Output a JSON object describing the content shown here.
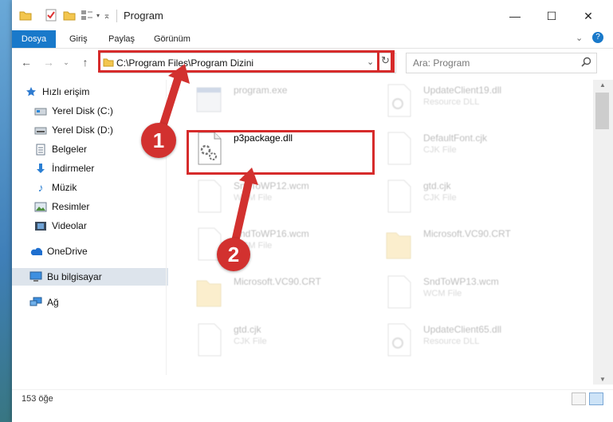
{
  "window": {
    "title": "Program",
    "controls": {
      "minimize": "—",
      "maximize": "☐",
      "close": "✕"
    }
  },
  "ribbon": {
    "tabs": [
      "Dosya",
      "Giriş",
      "Paylaş",
      "Görünüm"
    ],
    "collapse_icon": "chevron-down-icon",
    "help_icon": "help-icon"
  },
  "navigation": {
    "address": "C:\\Program Files\\Program Dizini",
    "search_placeholder": "Ara: Program"
  },
  "sidebar": {
    "items": [
      {
        "label": "Hızlı erişim",
        "icon": "star-icon",
        "pinned": false
      },
      {
        "label": "Yerel Disk (C:)",
        "icon": "drive-icon",
        "pinned": true
      },
      {
        "label": "Yerel Disk (D:)",
        "icon": "drive-icon",
        "pinned": false
      },
      {
        "label": "Belgeler",
        "icon": "documents-icon",
        "pinned": true
      },
      {
        "label": "İndirmeler",
        "icon": "download-icon",
        "pinned": true
      },
      {
        "label": "Müzik",
        "icon": "music-icon",
        "pinned": true
      },
      {
        "label": "Resimler",
        "icon": "pictures-icon",
        "pinned": true
      },
      {
        "label": "Videolar",
        "icon": "video-icon",
        "pinned": true
      },
      {
        "label": "OneDrive",
        "icon": "cloud-icon",
        "pinned": false
      },
      {
        "label": "Bu bilgisayar",
        "icon": "computer-icon",
        "pinned": false,
        "selected": true
      },
      {
        "label": "Ağ",
        "icon": "network-icon",
        "pinned": false
      }
    ]
  },
  "files": [
    {
      "name": "program.exe",
      "type": "",
      "icon": "exe-icon",
      "faded": true
    },
    {
      "name": "UpdateClient19.dll",
      "type": "Resource DLL",
      "icon": "dll-icon",
      "faded": true
    },
    {
      "name": "p3package.dll",
      "type": "",
      "icon": "gear-file-icon",
      "faded": false,
      "highlighted": true
    },
    {
      "name": "DefaultFont.cjk",
      "type": "CJK File",
      "icon": "file-icon",
      "faded": true
    },
    {
      "name": "SndToWP12.wcm",
      "type": "WCM File",
      "icon": "file-icon",
      "faded": true
    },
    {
      "name": "gtd.cjk",
      "type": "CJK File",
      "icon": "file-icon",
      "faded": true
    },
    {
      "name": "SndToWP16.wcm",
      "type": "WCM File",
      "icon": "file-icon",
      "faded": true
    },
    {
      "name": "Microsoft.VC90.CRT",
      "type": "",
      "icon": "folder-icon",
      "faded": true
    },
    {
      "name": "Microsoft.VC90.CRT",
      "type": "",
      "icon": "folder-icon",
      "faded": true
    },
    {
      "name": "SndToWP13.wcm",
      "type": "WCM File",
      "icon": "file-icon",
      "faded": true
    },
    {
      "name": "gtd.cjk",
      "type": "CJK File",
      "icon": "file-icon",
      "faded": true
    },
    {
      "name": "UpdateClient65.dll",
      "type": "Resource DLL",
      "icon": "dll-icon",
      "faded": true
    }
  ],
  "status": {
    "item_count": "153 öğe"
  },
  "annotations": {
    "step1": "1",
    "step2": "2",
    "accent_color": "#d62b2b"
  }
}
